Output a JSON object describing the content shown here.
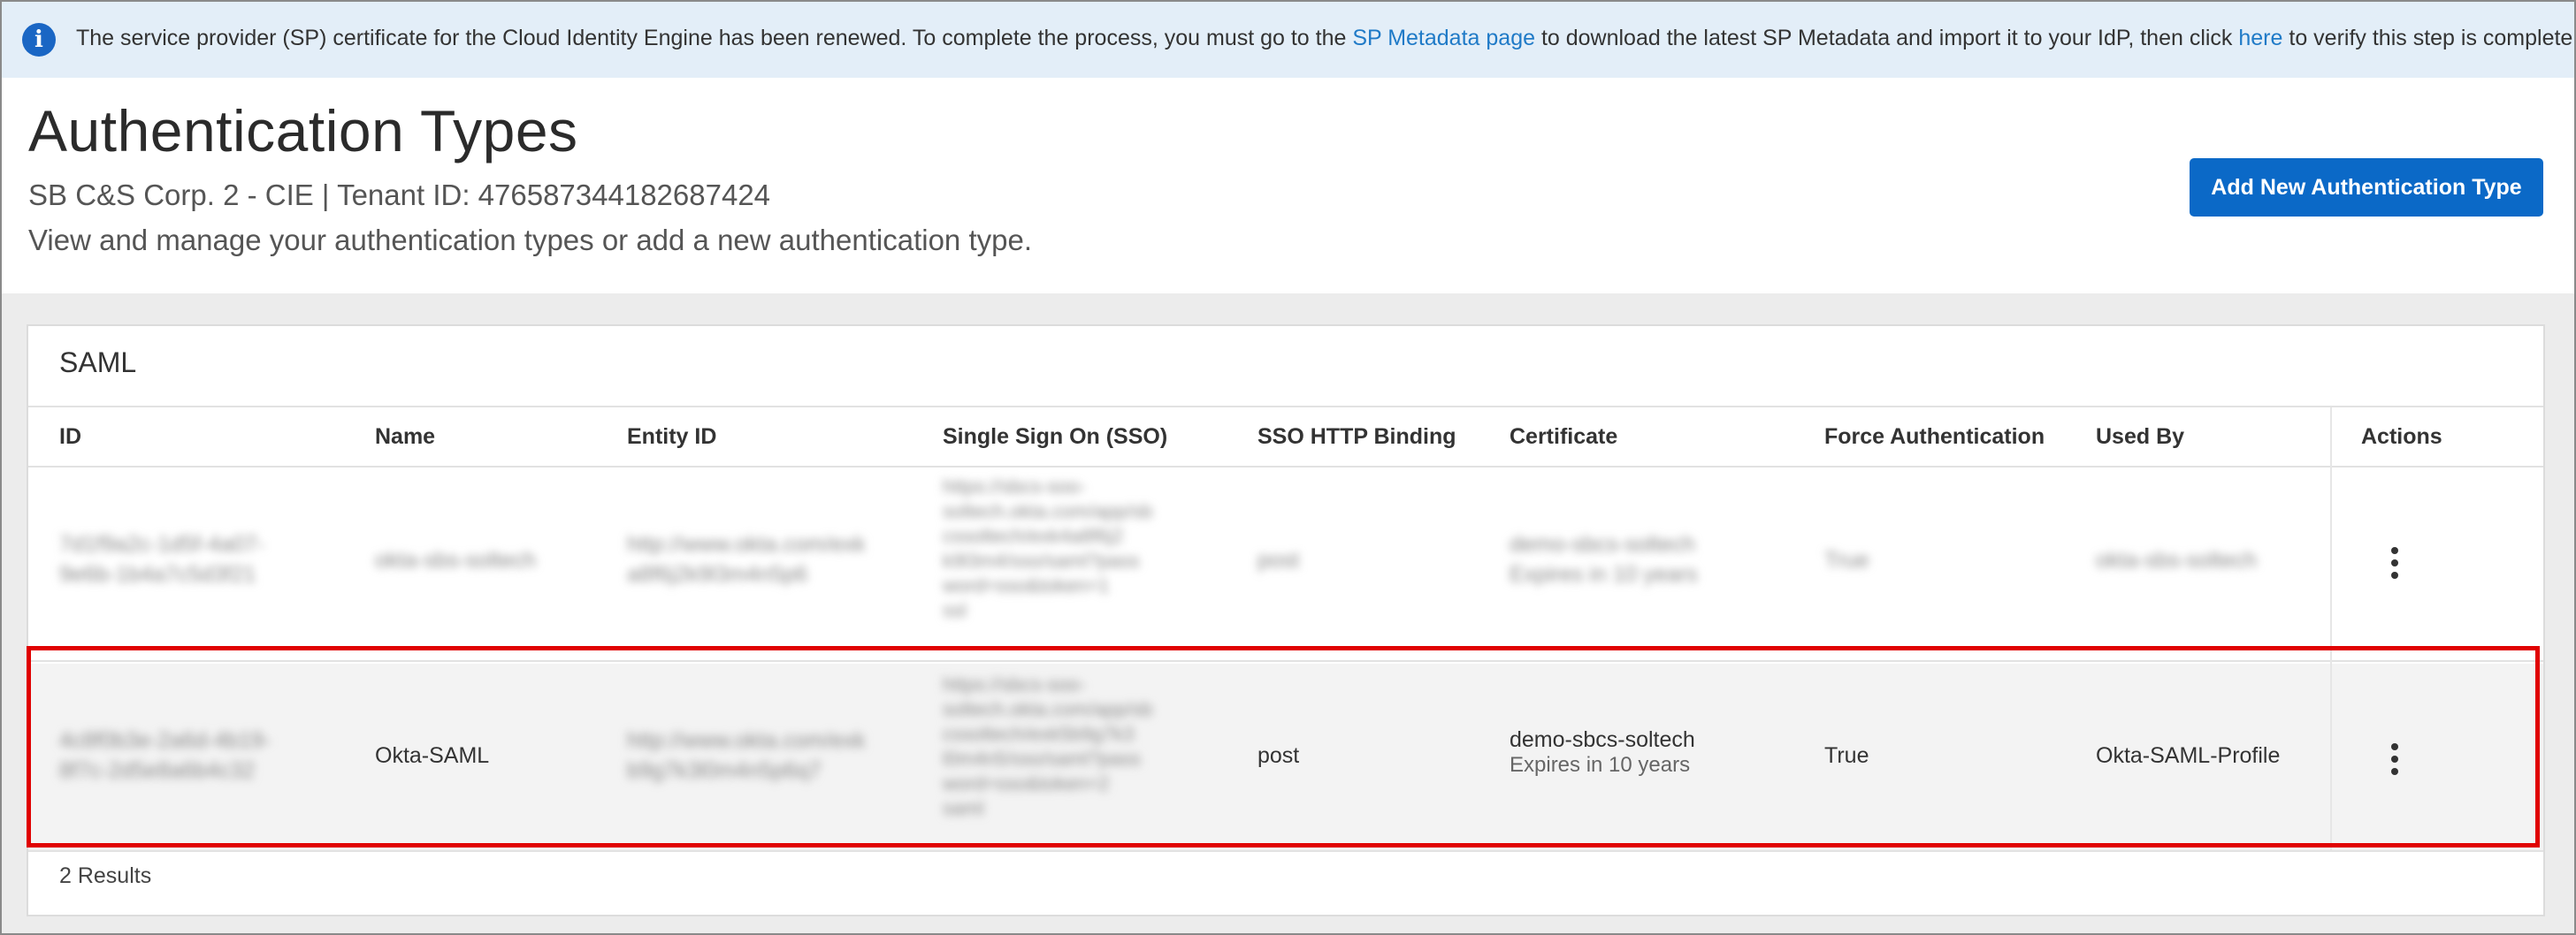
{
  "banner": {
    "icon": "info-icon",
    "text_before": "The service provider (SP) certificate for the Cloud Identity Engine has been renewed. To complete the process, you must go to the ",
    "link1": "SP Metadata page",
    "text_middle": " to download the latest SP Metadata and import it to your IdP, then click ",
    "link2": "here",
    "text_after": " to verify this step is complete.",
    "background": "#e3eef8",
    "link_color": "#1f7ac7"
  },
  "header": {
    "title": "Authentication Types",
    "tenant": "SB C&S Corp. 2 - CIE | Tenant ID: 476587344182687424",
    "description": "View and manage your authentication types or add a new authentication type.",
    "add_button": "Add New Authentication Type",
    "button_color": "#0b69c7"
  },
  "table": {
    "section_title": "SAML",
    "columns": [
      "ID",
      "Name",
      "Entity ID",
      "Single Sign On (SSO)",
      "SSO HTTP Binding",
      "Certificate",
      "Force Authentication",
      "Used By",
      "Actions"
    ],
    "rows": [
      {
        "id": [
          "7d1f9a2c-1d5f-4a07-",
          "9e6b-1b4a7c5d3f21"
        ],
        "name": "okta-sbs-soltech",
        "entity_id": [
          "http://www.okta.com/exk",
          "a8f6j2k9l3m4n5p6"
        ],
        "sso": [
          "https://sbcs-soo-",
          "soltech.okta.com/app/sb",
          "cssoltech/exk4a8f6j2",
          "k9l3m4/sso/saml?pass",
          "word=sso&token=1",
          "ssl"
        ],
        "binding": "post",
        "certificate": "demo-sbcs-soltech",
        "certificate_expiry": "Expires in 10 years",
        "force_auth": "True",
        "used_by": "okta-sbs-soltech",
        "actions_icon": "more-vertical-icon"
      },
      {
        "id": [
          "4c8f0b3e-2a6d-4b19-",
          "8f7c-2d5e8a6b4c32"
        ],
        "name": "Okta-SAML",
        "entity_id": [
          "http://www.okta.com/exk",
          "b9g7k3l0m4n5p6q7"
        ],
        "sso": [
          "https://sbcs-soo-",
          "soltech.okta.com/app/sb",
          "cssoltech/exk5b9g7k3",
          "l0m4n5/sso/saml?pass",
          "word=sso&token=2",
          "saml"
        ],
        "binding": "post",
        "certificate": "demo-sbcs-soltech",
        "certificate_expiry": "Expires in 10 years",
        "force_auth": "True",
        "used_by": "Okta-SAML-Profile",
        "actions_icon": "more-vertical-icon"
      }
    ],
    "results": "2 Results",
    "highlight_color": "#e00000"
  }
}
